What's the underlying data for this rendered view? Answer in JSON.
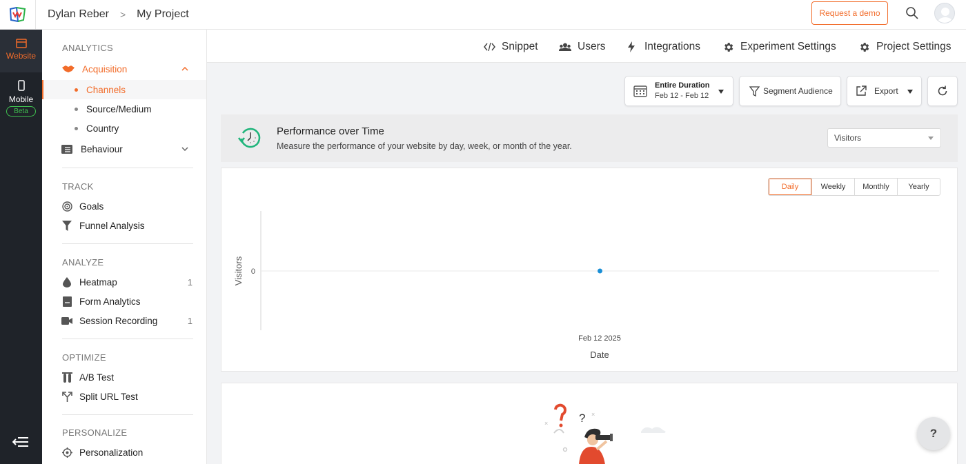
{
  "header": {
    "breadcrumb": [
      "Dylan Reber",
      "My Project"
    ],
    "breadcrumb_separator": ">",
    "demo_button": "Request a demo"
  },
  "rail": {
    "website": "Website",
    "mobile": "Mobile",
    "beta": "Beta"
  },
  "sidebar": {
    "analytics_title": "ANALYTICS",
    "acquisition": "Acquisition",
    "acquisition_sub": [
      "Channels",
      "Source/Medium",
      "Country"
    ],
    "behaviour": "Behaviour",
    "track_title": "TRACK",
    "goals": "Goals",
    "funnel": "Funnel Analysis",
    "analyze_title": "ANALYZE",
    "heatmap": "Heatmap",
    "heatmap_count": "1",
    "form_analytics": "Form Analytics",
    "session_recording": "Session Recording",
    "session_recording_count": "1",
    "optimize_title": "OPTIMIZE",
    "ab_test": "A/B Test",
    "split_url": "Split URL Test",
    "personalize_title": "PERSONALIZE",
    "personalization": "Personalization"
  },
  "topnav": {
    "snippet": "Snippet",
    "users": "Users",
    "integrations": "Integrations",
    "experiment_settings": "Experiment Settings",
    "project_settings": "Project Settings"
  },
  "toolbar": {
    "duration_label": "Entire Duration",
    "duration_range": "Feb 12 - Feb 12",
    "segment": "Segment Audience",
    "export": "Export"
  },
  "performance": {
    "title": "Performance over Time",
    "subtitle": "Measure the performance of your website by day, week, or month of the year.",
    "metric": "Visitors"
  },
  "period_tabs": [
    "Daily",
    "Weekly",
    "Monthly",
    "Yearly"
  ],
  "active_period": "Daily",
  "chart_data": {
    "type": "scatter",
    "x": [
      "Feb 12 2025"
    ],
    "series": [
      {
        "values": [
          0
        ]
      }
    ],
    "xlabel": "Date",
    "ylabel": "Visitors",
    "y_ticks": [
      "0"
    ],
    "grid": true,
    "point_color": "#1a8fd6"
  },
  "help": "?",
  "colors": {
    "accent": "#f26c2a",
    "rail": "#1f2329",
    "beta": "#3fbf4f"
  }
}
